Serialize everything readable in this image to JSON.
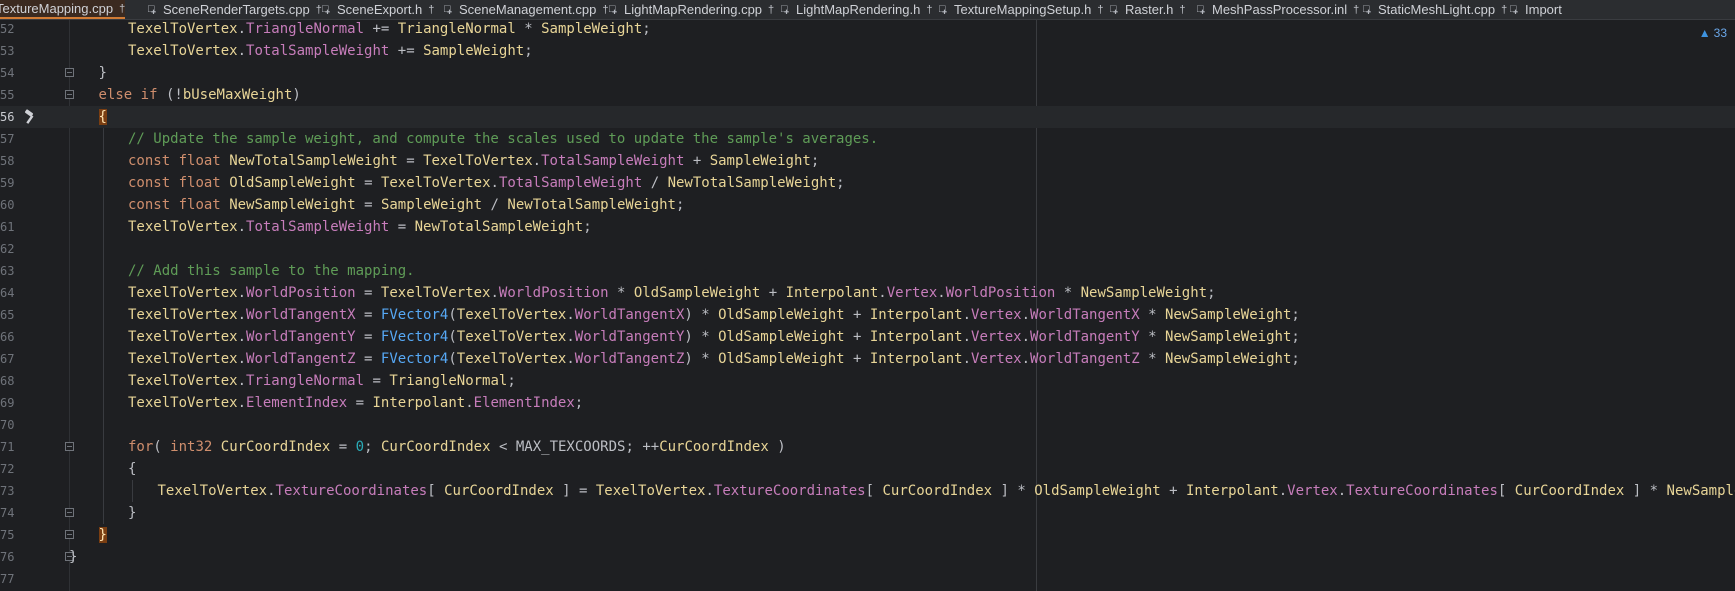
{
  "tabs": [
    {
      "label": "TextureMapping.cpp",
      "active": true
    },
    {
      "label": "SceneRenderTargets.cpp",
      "active": false
    },
    {
      "label": "SceneExport.h",
      "active": false
    },
    {
      "label": "SceneManagement.cpp",
      "active": false
    },
    {
      "label": "LightMapRendering.cpp",
      "active": false
    },
    {
      "label": "LightMapRendering.h",
      "active": false
    },
    {
      "label": "TextureMappingSetup.h",
      "active": false
    },
    {
      "label": "Raster.h",
      "active": false
    },
    {
      "label": "MeshPassProcessor.inl",
      "active": false
    },
    {
      "label": "StaticMeshLight.cpp",
      "active": false
    },
    {
      "label": "Import",
      "active": false
    }
  ],
  "inspection": {
    "icon": "warning-triangle-icon",
    "count": "33"
  },
  "current_line": "56",
  "lines": [
    {
      "n": "52",
      "code": "TexelToVertex.TriangleNormal += TriangleNormal * SampleWeight;"
    },
    {
      "n": "53",
      "code": "TexelToVertex.TotalSampleWeight += SampleWeight;"
    },
    {
      "n": "54",
      "code": "}"
    },
    {
      "n": "55",
      "code": "else if (!bUseMaxWeight)"
    },
    {
      "n": "56",
      "code": "{"
    },
    {
      "n": "57",
      "code": "// Update the sample weight, and compute the scales used to update the sample's averages."
    },
    {
      "n": "58",
      "code": "const float NewTotalSampleWeight = TexelToVertex.TotalSampleWeight + SampleWeight;"
    },
    {
      "n": "59",
      "code": "const float OldSampleWeight = TexelToVertex.TotalSampleWeight / NewTotalSampleWeight;"
    },
    {
      "n": "60",
      "code": "const float NewSampleWeight = SampleWeight / NewTotalSampleWeight;"
    },
    {
      "n": "61",
      "code": "TexelToVertex.TotalSampleWeight = NewTotalSampleWeight;"
    },
    {
      "n": "62",
      "code": ""
    },
    {
      "n": "63",
      "code": "// Add this sample to the mapping."
    },
    {
      "n": "64",
      "code": "TexelToVertex.WorldPosition = TexelToVertex.WorldPosition * OldSampleWeight + Interpolant.Vertex.WorldPosition * NewSampleWeight;"
    },
    {
      "n": "65",
      "code": "TexelToVertex.WorldTangentX = FVector4(TexelToVertex.WorldTangentX) * OldSampleWeight + Interpolant.Vertex.WorldTangentX * NewSampleWeight;"
    },
    {
      "n": "66",
      "code": "TexelToVertex.WorldTangentY = FVector4(TexelToVertex.WorldTangentY) * OldSampleWeight + Interpolant.Vertex.WorldTangentY * NewSampleWeight;"
    },
    {
      "n": "67",
      "code": "TexelToVertex.WorldTangentZ = FVector4(TexelToVertex.WorldTangentZ) * OldSampleWeight + Interpolant.Vertex.WorldTangentZ * NewSampleWeight;"
    },
    {
      "n": "68",
      "code": "TexelToVertex.TriangleNormal = TriangleNormal;"
    },
    {
      "n": "69",
      "code": "TexelToVertex.ElementIndex = Interpolant.ElementIndex;"
    },
    {
      "n": "70",
      "code": ""
    },
    {
      "n": "71",
      "code": "for( int32 CurCoordIndex = 0; CurCoordIndex < MAX_TEXCOORDS; ++CurCoordIndex )"
    },
    {
      "n": "72",
      "code": "{"
    },
    {
      "n": "73",
      "code": "TexelToVertex.TextureCoordinates[ CurCoordIndex ] = TexelToVertex.TextureCoordinates[ CurCoordIndex ] * OldSampleWeight + Interpolant.Vertex.TextureCoordinates[ CurCoordIndex ] * NewSampleWeight;"
    },
    {
      "n": "74",
      "code": "}"
    },
    {
      "n": "75",
      "code": "}"
    },
    {
      "n": "76",
      "code": "}"
    },
    {
      "n": "77",
      "code": ""
    }
  ],
  "colors": {
    "background": "#1e1f22",
    "keyword": "#cf8e6d",
    "field": "#c77dbb",
    "variable": "#e8d597",
    "function": "#56a8f5",
    "comment": "#5f9c57",
    "number": "#2aacb8",
    "active_tab_accent": "#d27c35"
  }
}
